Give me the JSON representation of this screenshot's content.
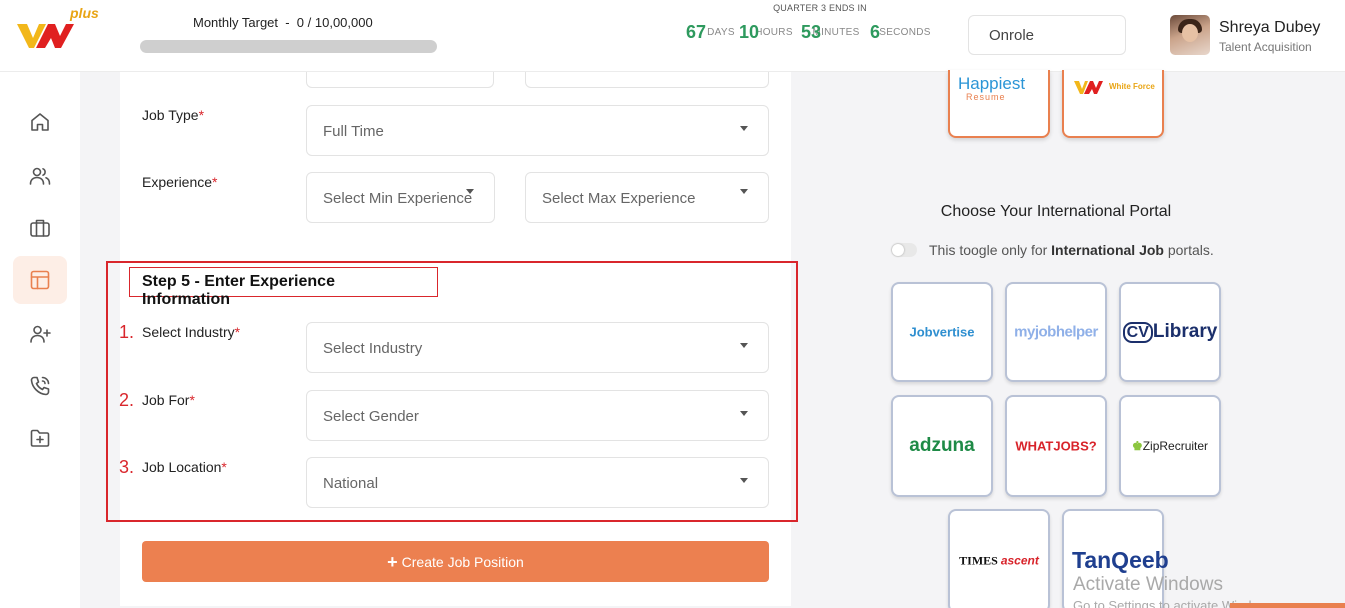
{
  "header": {
    "monthly_target_label": "Monthly Target  -  0 / 10,00,000",
    "target_progress": 0,
    "logo_badge": "plus",
    "countdown": {
      "title": "QUARTER 3 ENDS IN",
      "units": [
        {
          "value": "67",
          "label": "DAYS"
        },
        {
          "value": "10",
          "label": "HOURS"
        },
        {
          "value": "53",
          "label": "MINUTES"
        },
        {
          "value": "6",
          "label": "SECONDS"
        }
      ]
    },
    "role_select": "Onrole",
    "user": {
      "name": "Shreya Dubey",
      "title": "Talent Acquisition"
    }
  },
  "sidebar": {
    "items": [
      {
        "name": "home",
        "icon": "home-icon",
        "active": false
      },
      {
        "name": "users",
        "icon": "users-icon",
        "active": false
      },
      {
        "name": "jobs",
        "icon": "briefcase-icon",
        "active": false
      },
      {
        "name": "layout",
        "icon": "layout-icon",
        "active": true
      },
      {
        "name": "add-user",
        "icon": "user-plus-icon",
        "active": false
      },
      {
        "name": "calls",
        "icon": "phone-call-icon",
        "active": false
      },
      {
        "name": "add-folder",
        "icon": "folder-plus-icon",
        "active": false
      }
    ]
  },
  "form": {
    "job_type": {
      "label": "Job Type",
      "value": "Full Time"
    },
    "experience": {
      "label": "Experience",
      "min_placeholder": "Select Min Experience",
      "max_placeholder": "Select Max Experience"
    },
    "step5": {
      "title": "Step 5 - Enter Experience Information",
      "industry": {
        "number": "1.",
        "label": "Select Industry",
        "placeholder": "Select Industry"
      },
      "job_for": {
        "number": "2.",
        "label": "Job For",
        "placeholder": "Select Gender"
      },
      "job_location": {
        "number": "3.",
        "label": "Job Location",
        "value": "National"
      }
    },
    "required_mark": "*",
    "create_button": "Create Job Position",
    "create_button_icon": "+"
  },
  "portals": {
    "top": [
      {
        "name": "Happiest Resume",
        "text_main": "Happiest",
        "text_sub": "Resume"
      },
      {
        "name": "White Force",
        "text_main": "White Force"
      }
    ],
    "international": {
      "title": "Choose Your International Portal",
      "toggle_text_pre": "This toogle only for ",
      "toggle_text_bold": "International Job",
      "toggle_text_post": " portals.",
      "toggle_on": false,
      "items": [
        {
          "name": "Jobvertise"
        },
        {
          "name": "myjobhelper"
        },
        {
          "name": "CV Library",
          "badge": "CV",
          "text": "Library"
        },
        {
          "name": "adzuna"
        },
        {
          "name": "WHATJOBS?"
        },
        {
          "name": "ZipRecruiter"
        },
        {
          "name": "TIMES ascent",
          "text_a": "TIMES",
          "text_b": "ascent"
        },
        {
          "name": "TanQeeb"
        }
      ]
    }
  },
  "watermark": {
    "line1": "Activate Windows",
    "line2": "Go to Settings to activate Windows."
  },
  "colors": {
    "accent": "#ec8050",
    "countdown_green": "#2e9a5e",
    "required_red": "#d9262c",
    "tile_border_blue": "#b9c2d6"
  }
}
